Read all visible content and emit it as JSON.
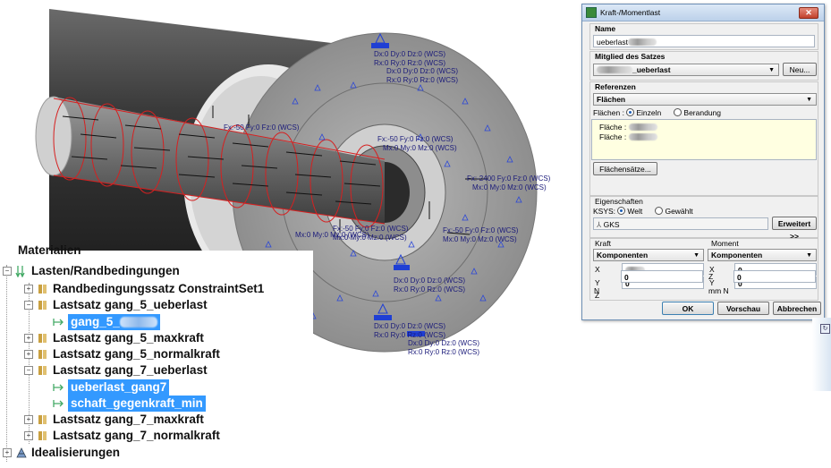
{
  "viewport": {
    "annotations": [
      "Dx:0 Dy:0 Dz:0 (WCS)",
      "Rx:0 Ry:0 Rz:0 (WCS)",
      "Dx:0 Dy:0 Dz:0 (WCS)",
      "Rx:0 Ry:0 Rz:0 (WCS)",
      "Fx:-50 Fy:0 Fz:0 (WCS)",
      "Mx:0 My:0 Mz:0 (WCS)",
      "Fx:-2400 Fy:0 Fz:0 (WCS)",
      "Mx:0 My:0 Mz:0 (WCS)",
      "Fx:-50 Fy:0 Fz:0 (WCS)",
      "Mx:0 My:0 Mz:0 (WCS)",
      "Fx:-50 Fy:0 Fz:0 (WCS)",
      "Mx:0 My:0 Mz:0 (WCS)",
      "Fx:-50 Fy:0 Fz:0 (WCS)",
      "Mx:0 My:0 Mz:0 (WCS)",
      "Dx:0 Dy:0 Dz:0 (WCS)",
      "Rx:0 Ry:0 Rz:0 (WCS)",
      "Dx:0 Dy:0 Dz:0 (WCS)",
      "Rx:0 Ry:0 Rz:0 (WCS)",
      "Dx:0 Dy:0 Dz:0 (WCS)",
      "Rx:0 Ry:0 Rz:0 (WCS)"
    ]
  },
  "tree": {
    "partial_top": "Materialien",
    "items": [
      {
        "label": "Lasten/Randbedingungen"
      },
      {
        "label": "Randbedingungssatz ConstraintSet1"
      },
      {
        "label": "Lastsatz gang_5_ueberlast"
      },
      {
        "label": "gang_5_"
      },
      {
        "label": "Lastsatz gang_5_maxkraft"
      },
      {
        "label": "Lastsatz gang_5_normalkraft"
      },
      {
        "label": "Lastsatz gang_7_ueberlast"
      },
      {
        "label": "ueberlast_gang7"
      },
      {
        "label": "schaft_gegenkraft_min"
      },
      {
        "label": "Lastsatz gang_7_maxkraft"
      },
      {
        "label": "Lastsatz gang_7_normalkraft"
      },
      {
        "label": "Idealisierungen"
      }
    ],
    "toggles": {
      "collapsed": "+",
      "expanded": "−"
    }
  },
  "dialog": {
    "title": "Kraft-/Momentlast",
    "close": "✕",
    "name_label": "Name",
    "name_value": "ueberlast",
    "member_label": "Mitglied des Satzes",
    "member_value": "_ueberlast",
    "new_button": "Neu...",
    "references_label": "Referenzen",
    "references_value": "Flächen",
    "surfaces_label": "Flächen :",
    "radio_single": "Einzeln",
    "radio_boundary": "Berandung",
    "list_items": [
      "Fläche :",
      "Fläche :"
    ],
    "surface_sets_button": "Flächensätze...",
    "properties_label": "Eigenschaften",
    "ksys_label": "KSYS:",
    "radio_world": "Welt",
    "radio_selected": "Gewählt",
    "coord_system": "GKS",
    "extended_button": "Erweitert >>",
    "force_label": "Kraft",
    "force_mode": "Komponenten",
    "moment_label": "Moment",
    "moment_mode": "Komponenten",
    "force_x_label": "X",
    "force_y_label": "Y",
    "force_y_value": "0",
    "force_z_label": "Z",
    "force_z_value": "0",
    "force_unit": "N",
    "moment_x_label": "X",
    "moment_x_value": "0",
    "moment_y_label": "Y",
    "moment_y_value": "0",
    "moment_z_label": "Z",
    "moment_z_value": "0",
    "moment_unit": "mm N",
    "ok_button": "OK",
    "preview_button": "Vorschau",
    "cancel_button": "Abbrechen"
  }
}
